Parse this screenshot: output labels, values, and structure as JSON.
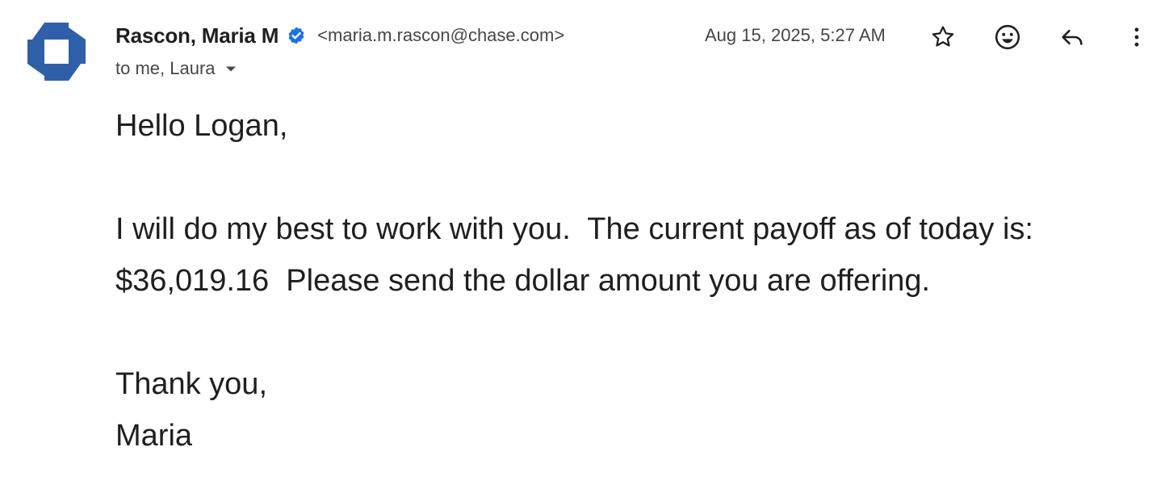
{
  "email": {
    "sender": {
      "name": "Rascon, Maria M",
      "email": "<maria.m.rascon@chase.com>",
      "verified": true,
      "avatar": "chase-octagon-logo",
      "avatar_color": "#2f5fa8"
    },
    "recipients": "to me, Laura",
    "date": "Aug 15, 2025, 5:27 AM",
    "actions": {
      "star_icon": "star-icon",
      "emoji_icon": "emoji-reaction-icon",
      "reply_icon": "reply-icon",
      "more_icon": "more-vert-icon"
    },
    "body": {
      "greeting": "Hello Logan,",
      "paragraph": "I will do my best to work with you.  The current payoff as of today is:  $36,019.16  Please send the dollar amount you are offering.",
      "closing": "Thank you,",
      "signature": "Maria"
    }
  },
  "colors": {
    "verified_badge": "#1a73e8",
    "secondary_text": "#444746",
    "primary_text": "#1f1f1f"
  }
}
